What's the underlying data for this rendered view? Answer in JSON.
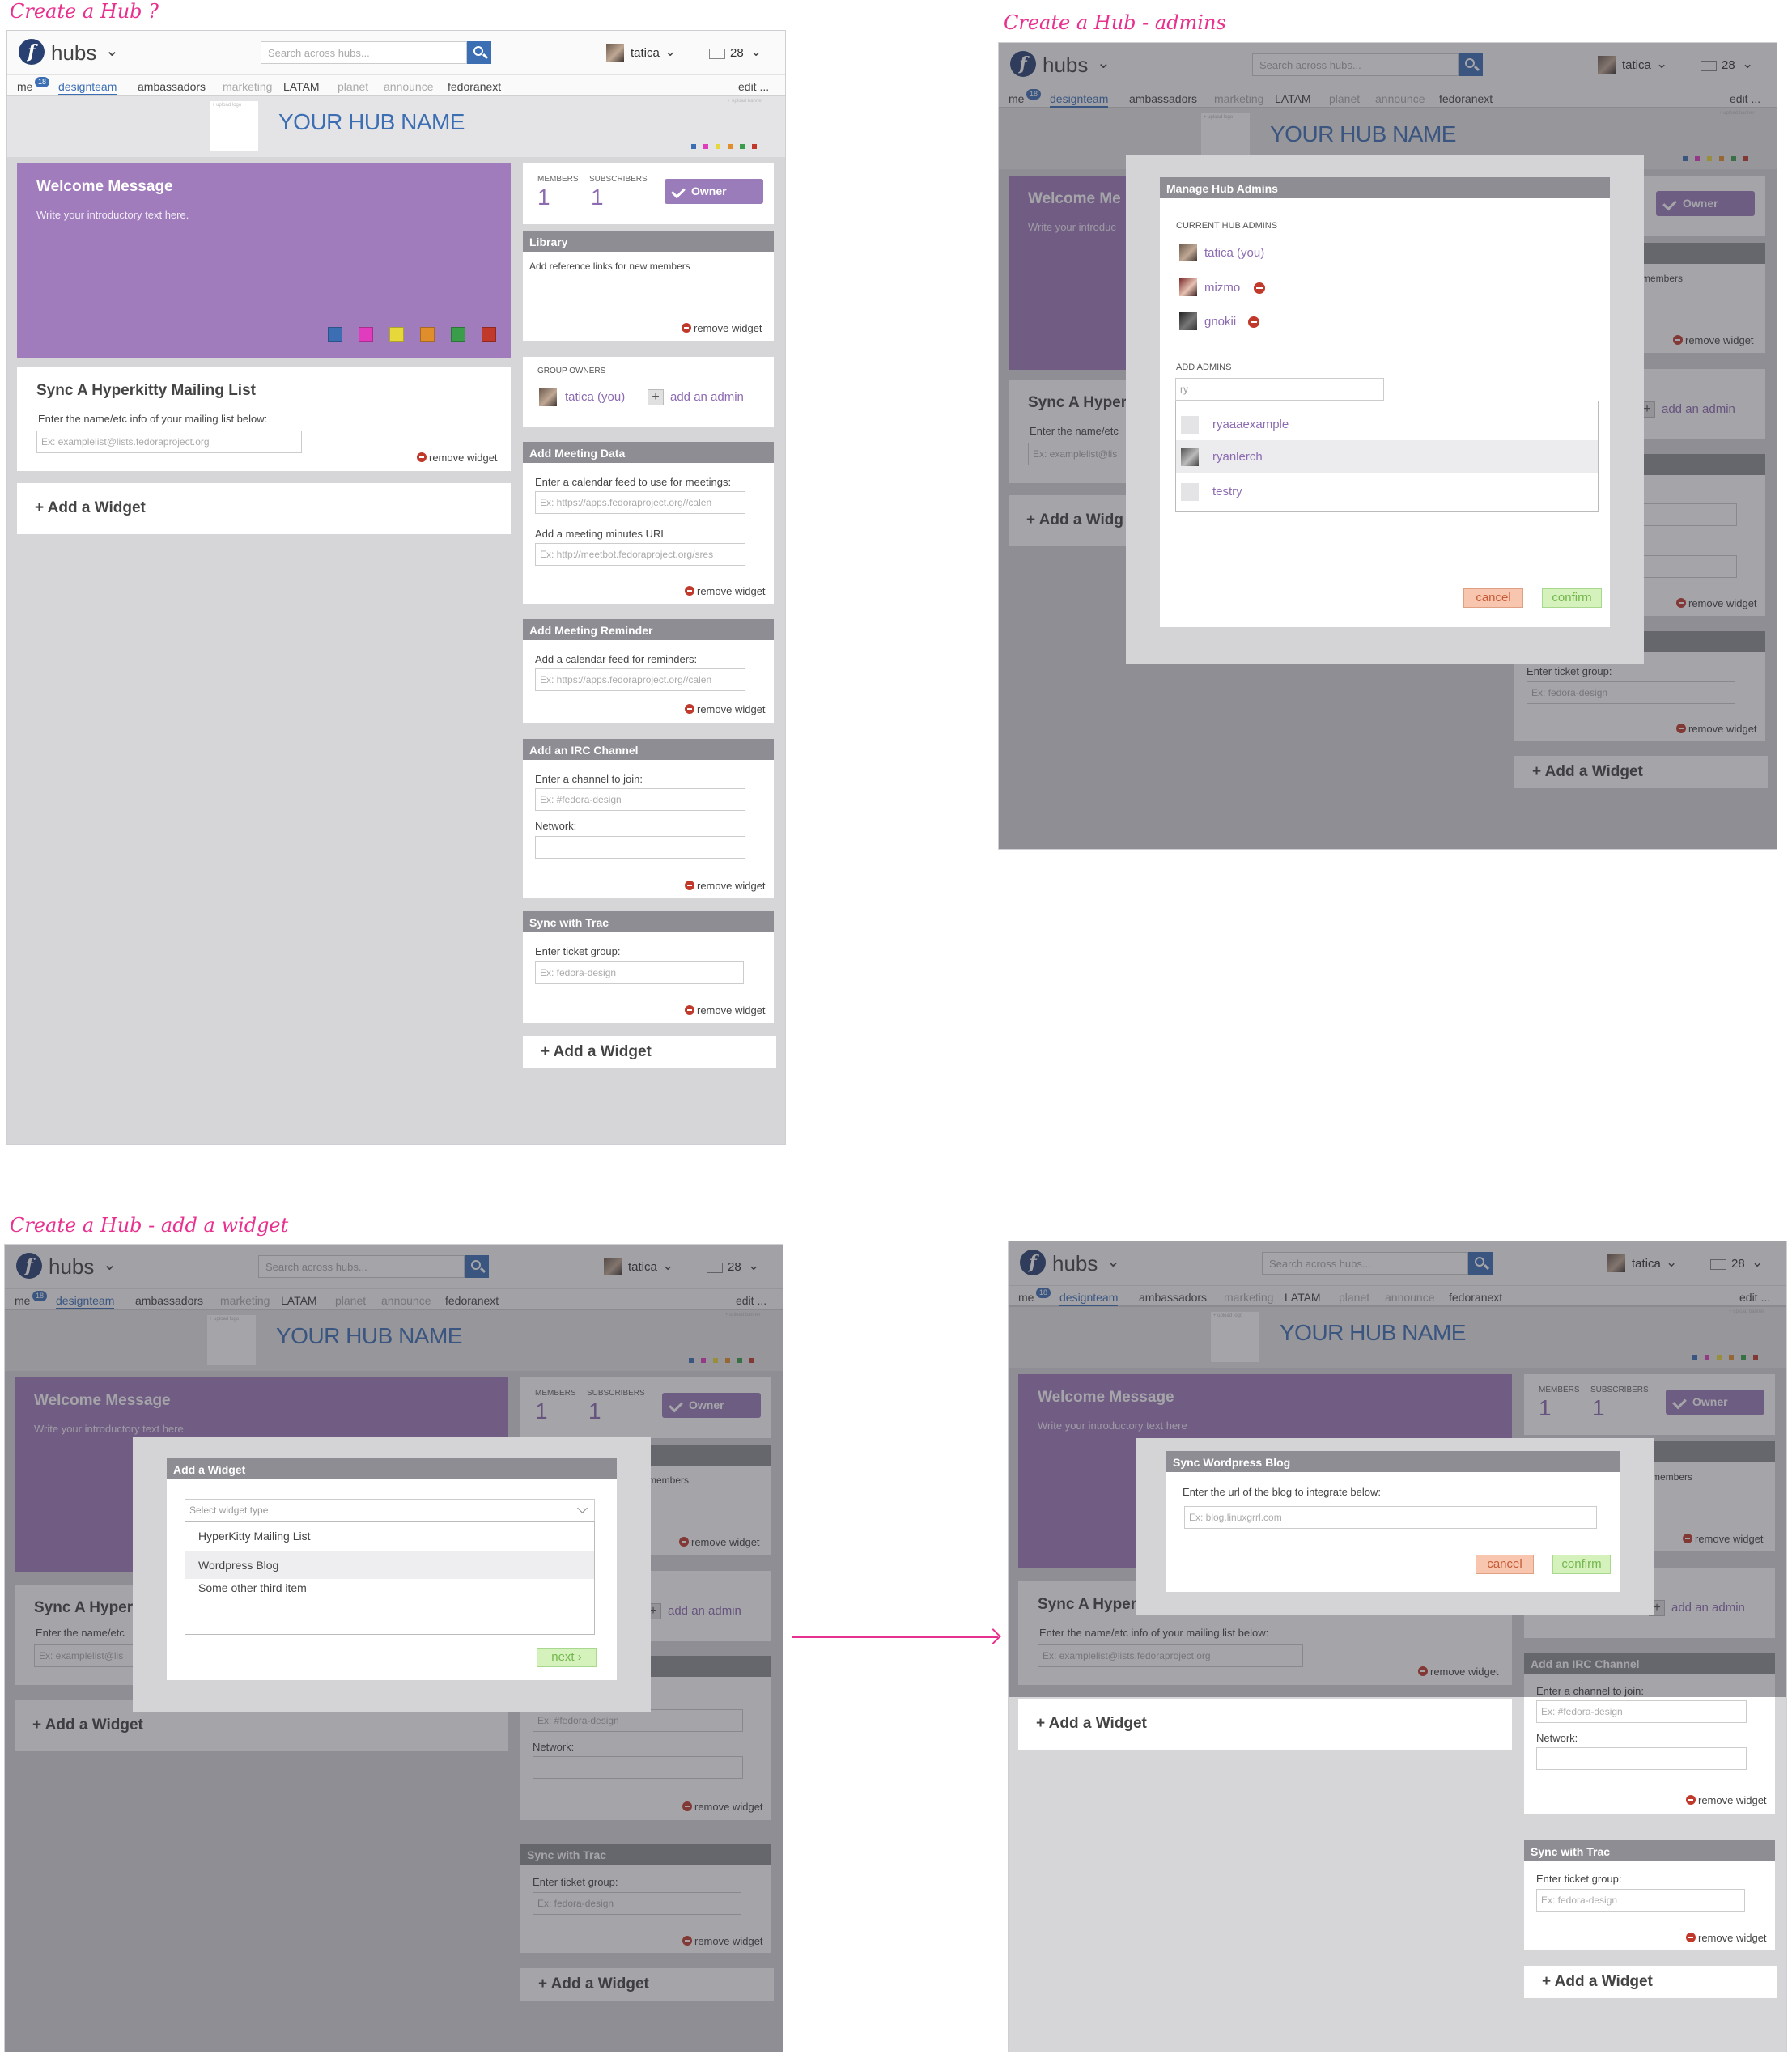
{
  "captions": [
    "Create a Hub ?",
    "Create a Hub -  admins",
    "Create a Hub - add a widget"
  ],
  "topbar": {
    "brand": "hubs",
    "search_placeholder": "Search across hubs...",
    "user": "tatica",
    "mail_count": "28"
  },
  "tabs": {
    "me": "me",
    "me_badge": "18",
    "designteam": "designteam",
    "ambassadors": "ambassadors",
    "marketing": "marketing",
    "latam": "LATAM",
    "planet": "planet",
    "announce": "announce",
    "fedoranext": "fedoranext",
    "edit": "edit ..."
  },
  "header": {
    "upload_logo": "+ upload logo",
    "upload_banner": "+ upload banner",
    "hub_name": "YOUR HUB NAME",
    "dot_colors": [
      "#3c6eb4",
      "#e03cbd",
      "#e6d83b",
      "#e08e2b",
      "#3a9d49",
      "#c0392b"
    ]
  },
  "welcome": {
    "title": "Welcome Message",
    "text": "Write your introductory text here.",
    "short_title": "Welcome Me",
    "short_text": "Write your introduc",
    "cut_text": "Write your introductory text here",
    "swatches": [
      "#3c6eb4",
      "#e03cbd",
      "#e6d83b",
      "#e08e2b",
      "#3a9d49",
      "#c0392b"
    ]
  },
  "mailing": {
    "title": "Sync A Hyperkitty Mailing List",
    "short_title": "Sync A Hyper",
    "hint": "Enter the name/etc info of your mailing list below:",
    "short_hint": "Enter the name/etc",
    "short_hint2": "Enter the name/etc",
    "placeholder": "Ex: examplelist@lists.fedoraproject.org",
    "short_placeholder": "Ex: examplelist@lis",
    "short_placeholder2": "Ex: examplelist@lis"
  },
  "add_widget": "+ Add a Widget",
  "add_widget_short": "+ Add a Widg",
  "remove_widget": "remove widget",
  "stats": {
    "members_label": "MEMBERS",
    "members_value": "1",
    "subscribers_label": "SUBSCRIBERS",
    "subscribers_value": "1",
    "owner": "Owner"
  },
  "library": {
    "title": "Library",
    "text": "Add reference links for new members",
    "short_text": "members"
  },
  "group_owners": {
    "label": "GROUP OWNERS",
    "owner": "tatica (you)",
    "add_admin": "add an admin"
  },
  "meeting_data": {
    "title": "Add Meeting Data",
    "cal_label": "Enter a calendar feed to use for meetings:",
    "cal_placeholder": "Ex: https://apps.fedoraproject.org//calen",
    "minutes_label": "Add a meeting minutes URL",
    "minutes_placeholder": "Ex: http://meetbot.fedoraproject.org/sres"
  },
  "meeting_reminder": {
    "title": "Add Meeting Reminder",
    "label": "Add a calendar feed for reminders:",
    "placeholder": "Ex: https://apps.fedoraproject.org//calen"
  },
  "irc": {
    "title": "Add an IRC Channel",
    "label": "Enter a channel to join:",
    "placeholder": "Ex: #fedora-design",
    "network_label": "Network:"
  },
  "trac": {
    "title": "Sync with Trac",
    "label": "Enter ticket group:",
    "placeholder": "Ex: fedora-design"
  },
  "admins_modal": {
    "title": "Manage Hub Admins",
    "current_label": "CURRENT HUB ADMINS",
    "admins": [
      "tatica (you)",
      "mizmo",
      "gnokii"
    ],
    "add_label": "ADD ADMINS",
    "query": "ry",
    "suggestions": [
      "ryaaaexample",
      "ryanlerch",
      "testry"
    ],
    "cancel": "cancel",
    "confirm": "confirm"
  },
  "add_widget_modal": {
    "title": "Add a Widget",
    "select_placeholder": "Select widget type",
    "options": [
      "HyperKitty Mailing List",
      "Wordpress Blog",
      "Some other third item"
    ],
    "next": "next"
  },
  "wordpress_modal": {
    "title": "Sync Wordpress Blog",
    "label": "Enter the url of the blog to integrate below:",
    "placeholder": "Ex: blog.linuxgrrl.com",
    "cancel": "cancel",
    "confirm": "confirm"
  }
}
